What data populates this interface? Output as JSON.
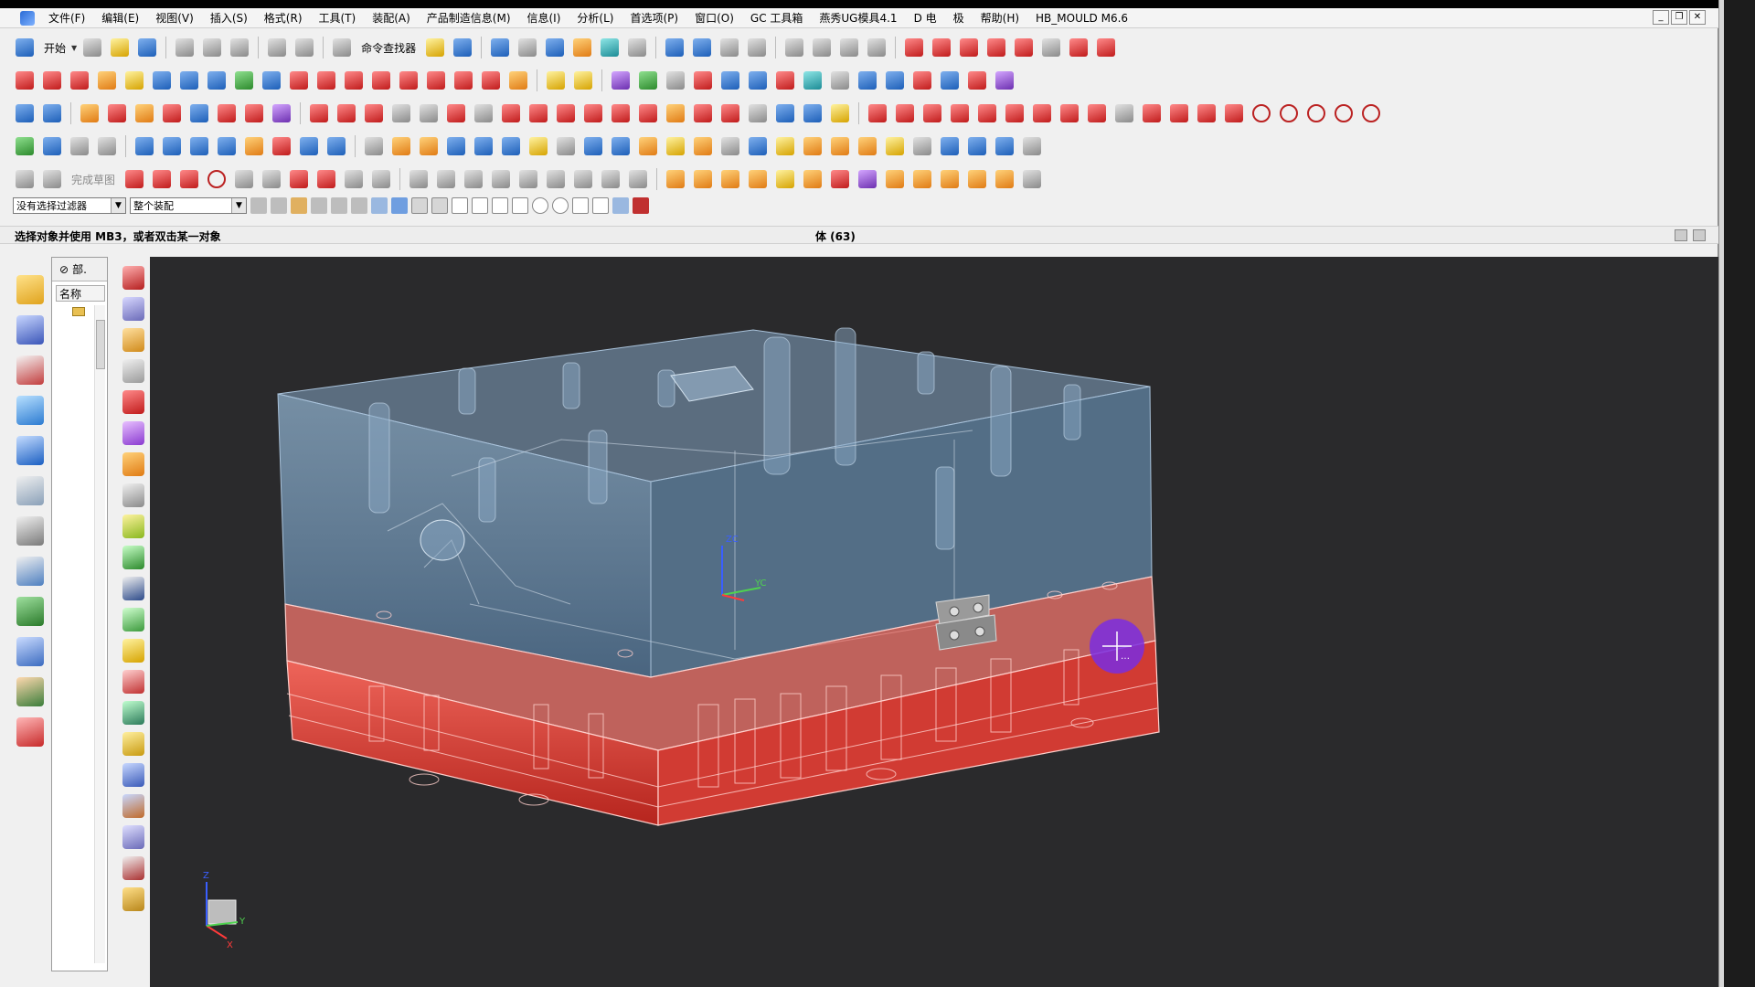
{
  "menubar": {
    "items": [
      "文件(F)",
      "编辑(E)",
      "视图(V)",
      "插入(S)",
      "格式(R)",
      "工具(T)",
      "装配(A)",
      "产品制造信息(M)",
      "信息(I)",
      "分析(L)",
      "首选项(P)",
      "窗口(O)",
      "GC 工具箱",
      "燕秀UG模具4.1",
      "D 电",
      "极",
      "帮助(H)",
      "HB_MOULD M6.6"
    ],
    "window_controls": [
      "_",
      "❐",
      "✕"
    ]
  },
  "toolbar": {
    "start_label": "开始",
    "command_finder_label": "命令查找器",
    "sketch_done_label": "完成草图"
  },
  "selection_bar": {
    "filter_value": "没有选择过滤器",
    "scope_value": "整个装配"
  },
  "status": {
    "prompt": "选择对象并使用 MB3，或者双击某一对象",
    "body_count": "体 (63)"
  },
  "navigator": {
    "tab_label": "部.",
    "column_header": "名称"
  },
  "colors": {
    "viewport_bg": "#2a2a2c",
    "upper_plate": "#6f8fb0",
    "lower_plate": "#e4473f",
    "cursor": "#7a2ee0"
  },
  "triad": {
    "z": "Z",
    "y": "Y",
    "x": "X"
  },
  "wcs": {
    "zc": "ZC",
    "yc": "YC"
  }
}
